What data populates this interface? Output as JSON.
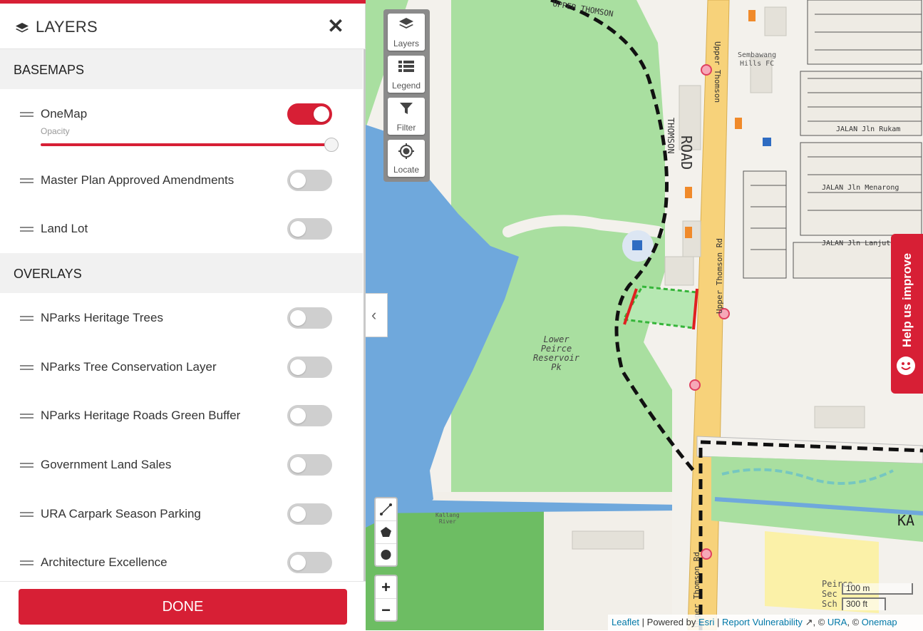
{
  "panel": {
    "title": "LAYERS",
    "close_symbol": "✕",
    "basemaps_heading": "BASEMAPS",
    "basemaps": [
      {
        "label": "OneMap",
        "enabled": true,
        "opacity_label": "Opacity",
        "opacity": 1.0
      },
      {
        "label": "Master Plan Approved Amendments",
        "enabled": false
      },
      {
        "label": "Land Lot",
        "enabled": false
      }
    ],
    "overlays_heading": "OVERLAYS",
    "overlays": [
      {
        "label": "NParks Heritage Trees",
        "enabled": false
      },
      {
        "label": "NParks Tree Conservation Layer",
        "enabled": false
      },
      {
        "label": "NParks Heritage Roads Green Buffer",
        "enabled": false
      },
      {
        "label": "Government Land Sales",
        "enabled": false
      },
      {
        "label": "URA Carpark Season Parking",
        "enabled": false
      },
      {
        "label": "Architecture Excellence",
        "enabled": false
      }
    ],
    "done_label": "DONE",
    "collapse_symbol": "‹"
  },
  "map_tools": {
    "layers": "Layers",
    "legend": "Legend",
    "filter": "Filter",
    "locate": "Locate"
  },
  "zoom": {
    "in": "+",
    "out": "−"
  },
  "scale": {
    "metric": "100 m",
    "imperial": "300 ft"
  },
  "attribution": {
    "leaflet": "Leaflet",
    "powered_by": "Powered by",
    "esri": "Esri",
    "report": "Report Vulnerability",
    "ura": "URA",
    "onemap": "Onemap",
    "copyright_sep_1": ", ©",
    "copyright_sep_2": ", ©"
  },
  "feedback": {
    "label": "Help us improve"
  },
  "map_labels": {
    "park": [
      "Lower",
      "Peirce",
      "Reservoir",
      "Pk"
    ],
    "road_main": "ROAD",
    "road_thomson": "THOMSON",
    "upper_thomson_1": "Upper Thomson",
    "upper_thomson_2": "Upper Thomson Rd",
    "upper_thomson_3": "Upper Thomson Rd",
    "sembawang": [
      "Sembawang",
      "Hills FC"
    ],
    "rukam": "JALAN Jln Rukam",
    "menarong": "JALAN Jln Menarong",
    "lanjut": "JALAN Jln Lanjut",
    "kallang_river": [
      "Kallang",
      "River"
    ],
    "peirce_sec": [
      "Peirce",
      "Sec",
      "Sch"
    ],
    "upper_thomson_top": "UPPER THOMSON",
    "ka": "KA"
  },
  "colors": {
    "accent": "#d71f35",
    "water": "#6fa8dc",
    "park": "#a9dfa0",
    "road": "#f7d27a"
  }
}
